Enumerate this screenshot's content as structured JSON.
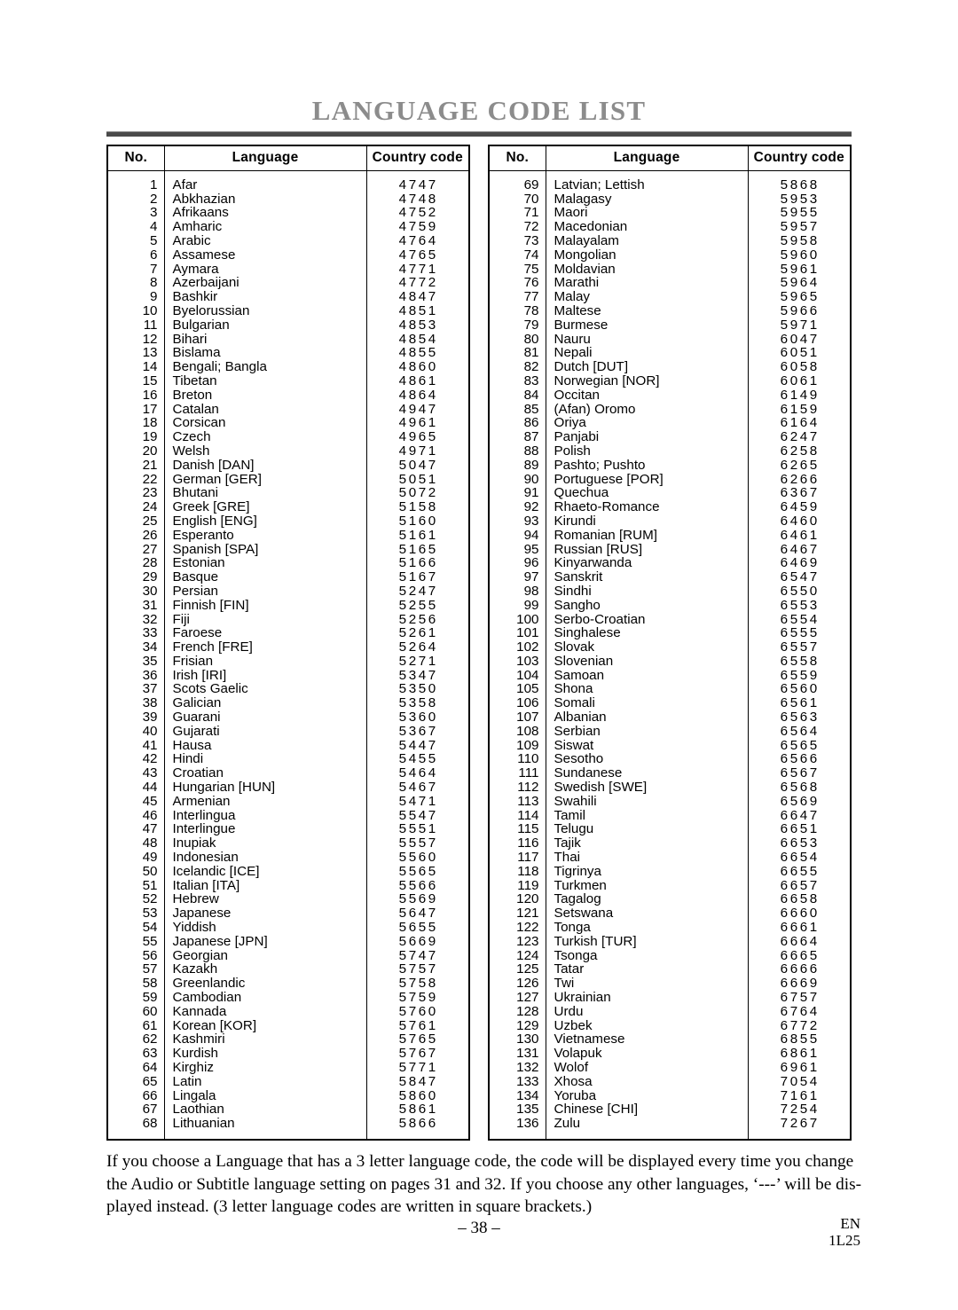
{
  "document": {
    "title": "LANGUAGE CODE LIST",
    "page_number": "– 38 –",
    "imprint_line1": "EN",
    "imprint_line2": "1L25"
  },
  "table_headers": {
    "no": "No.",
    "language": "Language",
    "country_code": "Country code"
  },
  "note": {
    "line1": "If you choose a Language that has a 3 letter language code, the code will be displayed every time you change",
    "line2": "the Audio or Subtitle language setting on pages 31 and 32. If you choose any other languages, ‘---’ will be dis-",
    "line3": "played instead. (3 letter language codes are written in square brackets.)"
  },
  "left_table": {
    "rows": [
      {
        "no": "1",
        "language": "Afar",
        "code": "4747"
      },
      {
        "no": "2",
        "language": "Abkhazian",
        "code": "4748"
      },
      {
        "no": "3",
        "language": "Afrikaans",
        "code": "4752"
      },
      {
        "no": "4",
        "language": "Amharic",
        "code": "4759"
      },
      {
        "no": "5",
        "language": "Arabic",
        "code": "4764"
      },
      {
        "no": "6",
        "language": "Assamese",
        "code": "4765"
      },
      {
        "no": "7",
        "language": "Aymara",
        "code": "4771"
      },
      {
        "no": "8",
        "language": "Azerbaijani",
        "code": "4772"
      },
      {
        "no": "9",
        "language": "Bashkir",
        "code": "4847"
      },
      {
        "no": "10",
        "language": "Byelorussian",
        "code": "4851"
      },
      {
        "no": "11",
        "language": "Bulgarian",
        "code": "4853"
      },
      {
        "no": "12",
        "language": "Bihari",
        "code": "4854"
      },
      {
        "no": "13",
        "language": "Bislama",
        "code": "4855"
      },
      {
        "no": "14",
        "language": "Bengali; Bangla",
        "code": "4860"
      },
      {
        "no": "15",
        "language": "Tibetan",
        "code": "4861"
      },
      {
        "no": "16",
        "language": "Breton",
        "code": "4864"
      },
      {
        "no": "17",
        "language": "Catalan",
        "code": "4947"
      },
      {
        "no": "18",
        "language": "Corsican",
        "code": "4961"
      },
      {
        "no": "19",
        "language": "Czech",
        "code": "4965"
      },
      {
        "no": "20",
        "language": "Welsh",
        "code": "4971"
      },
      {
        "no": "21",
        "language": "Danish [DAN]",
        "code": "5047"
      },
      {
        "no": "22",
        "language": "German [GER]",
        "code": "5051"
      },
      {
        "no": "23",
        "language": "Bhutani",
        "code": "5072"
      },
      {
        "no": "24",
        "language": "Greek [GRE]",
        "code": "5158"
      },
      {
        "no": "25",
        "language": "English [ENG]",
        "code": "5160"
      },
      {
        "no": "26",
        "language": "Esperanto",
        "code": "5161"
      },
      {
        "no": "27",
        "language": "Spanish [SPA]",
        "code": "5165"
      },
      {
        "no": "28",
        "language": "Estonian",
        "code": "5166"
      },
      {
        "no": "29",
        "language": "Basque",
        "code": "5167"
      },
      {
        "no": "30",
        "language": "Persian",
        "code": "5247"
      },
      {
        "no": "31",
        "language": "Finnish [FIN]",
        "code": "5255"
      },
      {
        "no": "32",
        "language": "Fiji",
        "code": "5256"
      },
      {
        "no": "33",
        "language": "Faroese",
        "code": "5261"
      },
      {
        "no": "34",
        "language": "French [FRE]",
        "code": "5264"
      },
      {
        "no": "35",
        "language": "Frisian",
        "code": "5271"
      },
      {
        "no": "36",
        "language": "Irish [IRI]",
        "code": "5347"
      },
      {
        "no": "37",
        "language": "Scots Gaelic",
        "code": "5350"
      },
      {
        "no": "38",
        "language": "Galician",
        "code": "5358"
      },
      {
        "no": "39",
        "language": "Guarani",
        "code": "5360"
      },
      {
        "no": "40",
        "language": "Gujarati",
        "code": "5367"
      },
      {
        "no": "41",
        "language": "Hausa",
        "code": "5447"
      },
      {
        "no": "42",
        "language": "Hindi",
        "code": "5455"
      },
      {
        "no": "43",
        "language": "Croatian",
        "code": "5464"
      },
      {
        "no": "44",
        "language": "Hungarian [HUN]",
        "code": "5467"
      },
      {
        "no": "45",
        "language": "Armenian",
        "code": "5471"
      },
      {
        "no": "46",
        "language": "Interlingua",
        "code": "5547"
      },
      {
        "no": "47",
        "language": "Interlingue",
        "code": "5551"
      },
      {
        "no": "48",
        "language": "Inupiak",
        "code": "5557"
      },
      {
        "no": "49",
        "language": "Indonesian",
        "code": "5560"
      },
      {
        "no": "50",
        "language": "Icelandic [ICE]",
        "code": "5565"
      },
      {
        "no": "51",
        "language": "Italian [ITA]",
        "code": "5566"
      },
      {
        "no": "52",
        "language": "Hebrew",
        "code": "5569"
      },
      {
        "no": "53",
        "language": "Japanese",
        "code": "5647"
      },
      {
        "no": "54",
        "language": "Yiddish",
        "code": "5655"
      },
      {
        "no": "55",
        "language": "Japanese [JPN]",
        "code": "5669"
      },
      {
        "no": "56",
        "language": "Georgian",
        "code": "5747"
      },
      {
        "no": "57",
        "language": "Kazakh",
        "code": "5757"
      },
      {
        "no": "58",
        "language": "Greenlandic",
        "code": "5758"
      },
      {
        "no": "59",
        "language": "Cambodian",
        "code": "5759"
      },
      {
        "no": "60",
        "language": "Kannada",
        "code": "5760"
      },
      {
        "no": "61",
        "language": "Korean [KOR]",
        "code": "5761"
      },
      {
        "no": "62",
        "language": "Kashmiri",
        "code": "5765"
      },
      {
        "no": "63",
        "language": "Kurdish",
        "code": "5767"
      },
      {
        "no": "64",
        "language": "Kirghiz",
        "code": "5771"
      },
      {
        "no": "65",
        "language": "Latin",
        "code": "5847"
      },
      {
        "no": "66",
        "language": "Lingala",
        "code": "5860"
      },
      {
        "no": "67",
        "language": "Laothian",
        "code": "5861"
      },
      {
        "no": "68",
        "language": "Lithuanian",
        "code": "5866"
      }
    ]
  },
  "right_table": {
    "rows": [
      {
        "no": "69",
        "language": "Latvian; Lettish",
        "code": "5868"
      },
      {
        "no": "70",
        "language": "Malagasy",
        "code": "5953"
      },
      {
        "no": "71",
        "language": "Maori",
        "code": "5955"
      },
      {
        "no": "72",
        "language": "Macedonian",
        "code": "5957"
      },
      {
        "no": "73",
        "language": "Malayalam",
        "code": "5958"
      },
      {
        "no": "74",
        "language": "Mongolian",
        "code": "5960"
      },
      {
        "no": "75",
        "language": "Moldavian",
        "code": "5961"
      },
      {
        "no": "76",
        "language": "Marathi",
        "code": "5964"
      },
      {
        "no": "77",
        "language": "Malay",
        "code": "5965"
      },
      {
        "no": "78",
        "language": "Maltese",
        "code": "5966"
      },
      {
        "no": "79",
        "language": "Burmese",
        "code": "5971"
      },
      {
        "no": "80",
        "language": "Nauru",
        "code": "6047"
      },
      {
        "no": "81",
        "language": "Nepali",
        "code": "6051"
      },
      {
        "no": "82",
        "language": "Dutch [DUT]",
        "code": "6058"
      },
      {
        "no": "83",
        "language": "Norwegian [NOR]",
        "code": "6061"
      },
      {
        "no": "84",
        "language": "Occitan",
        "code": "6149"
      },
      {
        "no": "85",
        "language": "(Afan) Oromo",
        "code": "6159"
      },
      {
        "no": "86",
        "language": "Oriya",
        "code": "6164"
      },
      {
        "no": "87",
        "language": "Panjabi",
        "code": "6247"
      },
      {
        "no": "88",
        "language": "Polish",
        "code": "6258"
      },
      {
        "no": "89",
        "language": "Pashto; Pushto",
        "code": "6265"
      },
      {
        "no": "90",
        "language": "Portuguese [POR]",
        "code": "6266"
      },
      {
        "no": "91",
        "language": "Quechua",
        "code": "6367"
      },
      {
        "no": "92",
        "language": "Rhaeto-Romance",
        "code": "6459"
      },
      {
        "no": "93",
        "language": "Kirundi",
        "code": "6460"
      },
      {
        "no": "94",
        "language": "Romanian [RUM]",
        "code": "6461"
      },
      {
        "no": "95",
        "language": "Russian [RUS]",
        "code": "6467"
      },
      {
        "no": "96",
        "language": "Kinyarwanda",
        "code": "6469"
      },
      {
        "no": "97",
        "language": "Sanskrit",
        "code": "6547"
      },
      {
        "no": "98",
        "language": "Sindhi",
        "code": "6550"
      },
      {
        "no": "99",
        "language": "Sangho",
        "code": "6553"
      },
      {
        "no": "100",
        "language": "Serbo-Croatian",
        "code": "6554"
      },
      {
        "no": "101",
        "language": "Singhalese",
        "code": "6555"
      },
      {
        "no": "102",
        "language": "Slovak",
        "code": "6557"
      },
      {
        "no": "103",
        "language": "Slovenian",
        "code": "6558"
      },
      {
        "no": "104",
        "language": "Samoan",
        "code": "6559"
      },
      {
        "no": "105",
        "language": "Shona",
        "code": "6560"
      },
      {
        "no": "106",
        "language": "Somali",
        "code": "6561"
      },
      {
        "no": "107",
        "language": "Albanian",
        "code": "6563"
      },
      {
        "no": "108",
        "language": "Serbian",
        "code": "6564"
      },
      {
        "no": "109",
        "language": "Siswat",
        "code": "6565"
      },
      {
        "no": "110",
        "language": "Sesotho",
        "code": "6566"
      },
      {
        "no": "111",
        "language": "Sundanese",
        "code": "6567"
      },
      {
        "no": "112",
        "language": "Swedish [SWE]",
        "code": "6568"
      },
      {
        "no": "113",
        "language": "Swahili",
        "code": "6569"
      },
      {
        "no": "114",
        "language": "Tamil",
        "code": "6647"
      },
      {
        "no": "115",
        "language": "Telugu",
        "code": "6651"
      },
      {
        "no": "116",
        "language": "Tajik",
        "code": "6653"
      },
      {
        "no": "117",
        "language": "Thai",
        "code": "6654"
      },
      {
        "no": "118",
        "language": "Tigrinya",
        "code": "6655"
      },
      {
        "no": "119",
        "language": "Turkmen",
        "code": "6657"
      },
      {
        "no": "120",
        "language": "Tagalog",
        "code": "6658"
      },
      {
        "no": "121",
        "language": "Setswana",
        "code": "6660"
      },
      {
        "no": "122",
        "language": "Tonga",
        "code": "6661"
      },
      {
        "no": "123",
        "language": "Turkish [TUR]",
        "code": "6664"
      },
      {
        "no": "124",
        "language": "Tsonga",
        "code": "6665"
      },
      {
        "no": "125",
        "language": "Tatar",
        "code": "6666"
      },
      {
        "no": "126",
        "language": "Twi",
        "code": "6669"
      },
      {
        "no": "127",
        "language": "Ukrainian",
        "code": "6757"
      },
      {
        "no": "128",
        "language": "Urdu",
        "code": "6764"
      },
      {
        "no": "129",
        "language": "Uzbek",
        "code": "6772"
      },
      {
        "no": "130",
        "language": "Vietnamese",
        "code": "6855"
      },
      {
        "no": "131",
        "language": "Volapuk",
        "code": "6861"
      },
      {
        "no": "132",
        "language": "Wolof",
        "code": "6961"
      },
      {
        "no": "133",
        "language": "Xhosa",
        "code": "7054"
      },
      {
        "no": "134",
        "language": "Yoruba",
        "code": "7161"
      },
      {
        "no": "135",
        "language": "Chinese [CHI]",
        "code": "7254"
      },
      {
        "no": "136",
        "language": "Zulu",
        "code": "7267"
      }
    ]
  }
}
